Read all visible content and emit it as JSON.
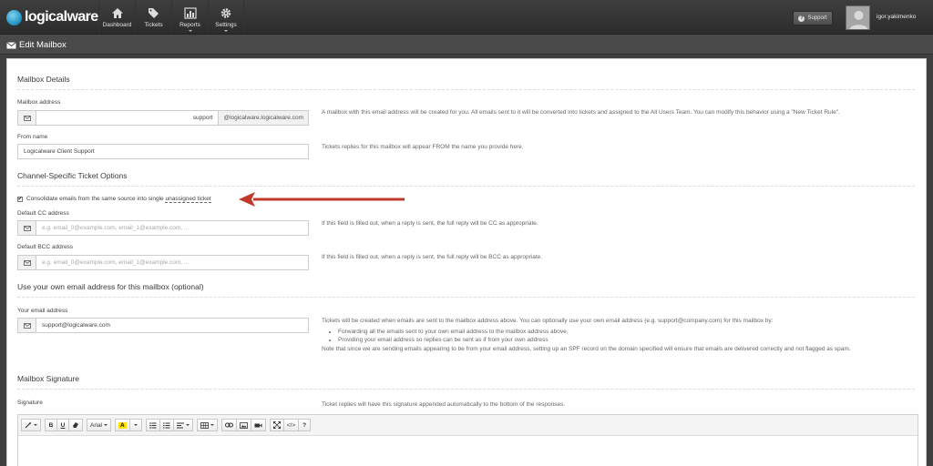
{
  "app": {
    "logo_text": "logicalware",
    "brand_color": "#1d8fc0"
  },
  "nav": [
    {
      "label": "Dashboard",
      "icon": "home-icon"
    },
    {
      "label": "Tickets",
      "icon": "tags-icon"
    },
    {
      "label": "Reports",
      "icon": "bar-chart-icon"
    },
    {
      "label": "Settings",
      "icon": "gear-icon"
    }
  ],
  "header": {
    "support_label": "Support",
    "user_name": "igor.yakimenko"
  },
  "page": {
    "title": "Edit Mailbox"
  },
  "sections": {
    "details": "Mailbox Details",
    "channel": "Channel-Specific Ticket Options",
    "own_email": "Use your own email address for this mailbox (optional)",
    "signature": "Mailbox Signature"
  },
  "fields": {
    "mailbox_address": {
      "label": "Mailbox address",
      "value": "support",
      "suffix": "@logicalware.logicalware.com",
      "help": "A mailbox with this email address will be created for you. All emails sent to it will be converted into tickets and assigned to the All Users Team. You can modify this behavior using a \"New Ticket Rule\"."
    },
    "from_name": {
      "label": "From name",
      "value": "Logicalware Client Support",
      "help": "Tickets replies for this mailbox will appear FROM the name you provide here."
    },
    "consolidate": {
      "label_prefix": "Consolidate emails from the same source into single ",
      "label_dotted": "unassigned ticket",
      "checked": true
    },
    "cc": {
      "label": "Default CC address",
      "placeholder": "e.g. email_0@example.com, email_1@example.com, ...",
      "help": "If this field is filled out, when a reply is sent, the full reply will be CC as appropriate."
    },
    "bcc": {
      "label": "Default BCC address",
      "placeholder": "e.g. email_0@example.com, email_1@example.com, ...",
      "help": "If this field is filled out, when a reply is sent, the full reply will be BCC as appropriate."
    },
    "your_email": {
      "label": "Your email address",
      "value": "support@logicalware.com",
      "help_intro": "Tickets will be created when emails are sent to the mailbox address above. You can optionally use your own email address (e.g. support@company.com) for this mailbox by:",
      "bullets": [
        "Forwarding all the emails sent to your own email address to the mailbox address above.",
        "Providing your email address so replies can be sent as if from your own address"
      ],
      "help_note": "Note that since we are sending emails appearing to be from your email address, setting up an SPF record on the domain specified will ensure that emails are delivered correctly and not flagged as spam."
    },
    "signature": {
      "label": "Signature",
      "help": "Ticket replies will have this signature appended automatically to the bottom of the responses."
    }
  },
  "editor": {
    "font_name": "Arial",
    "bold": "B",
    "underline": "U",
    "highlight": "A",
    "code": "</>",
    "help": "?"
  },
  "annotation": {
    "arrow_color": "#c0392b"
  }
}
